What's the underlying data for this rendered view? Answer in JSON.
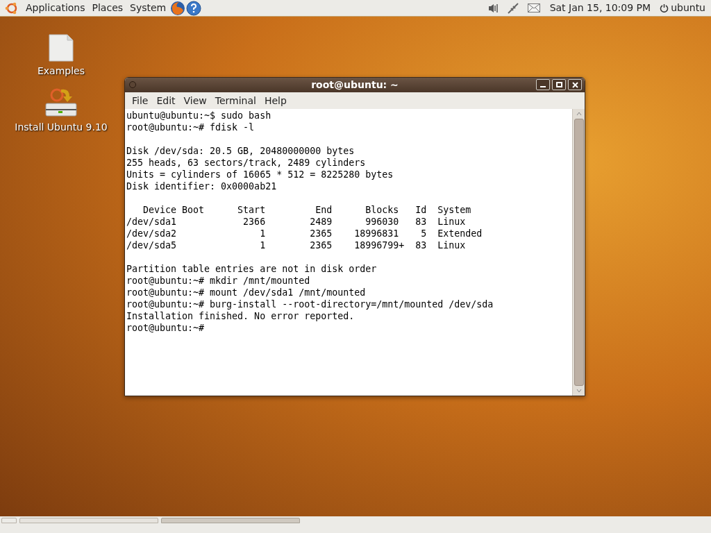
{
  "top_panel": {
    "menus": [
      "Applications",
      "Places",
      "System"
    ],
    "clock": "Sat Jan 15, 10:09 PM",
    "user": "ubuntu"
  },
  "desktop_icons": [
    {
      "kind": "document",
      "label": "Examples"
    },
    {
      "kind": "installer",
      "label": "Install Ubuntu 9.10"
    }
  ],
  "terminal": {
    "title": "root@ubuntu: ~",
    "menu": [
      "File",
      "Edit",
      "View",
      "Terminal",
      "Help"
    ],
    "blocks": [
      [
        "ubuntu@ubuntu:~$ sudo bash",
        "root@ubuntu:~# fdisk -l"
      ],
      [
        "Disk /dev/sda: 20.5 GB, 20480000000 bytes",
        "255 heads, 63 sectors/track, 2489 cylinders",
        "Units = cylinders of 16065 * 512 = 8225280 bytes",
        "Disk identifier: 0x0000ab21"
      ],
      [
        "   Device Boot      Start         End      Blocks   Id  System",
        "/dev/sda1            2366        2489      996030   83  Linux",
        "/dev/sda2               1        2365    18996831    5  Extended",
        "/dev/sda5               1        2365    18996799+  83  Linux"
      ],
      [
        "Partition table entries are not in disk order",
        "root@ubuntu:~# mkdir /mnt/mounted",
        "root@ubuntu:~# mount /dev/sda1 /mnt/mounted",
        "root@ubuntu:~# burg-install --root-directory=/mnt/mounted /dev/sda",
        "Installation finished. No error reported.",
        "root@ubuntu:~#"
      ]
    ]
  }
}
